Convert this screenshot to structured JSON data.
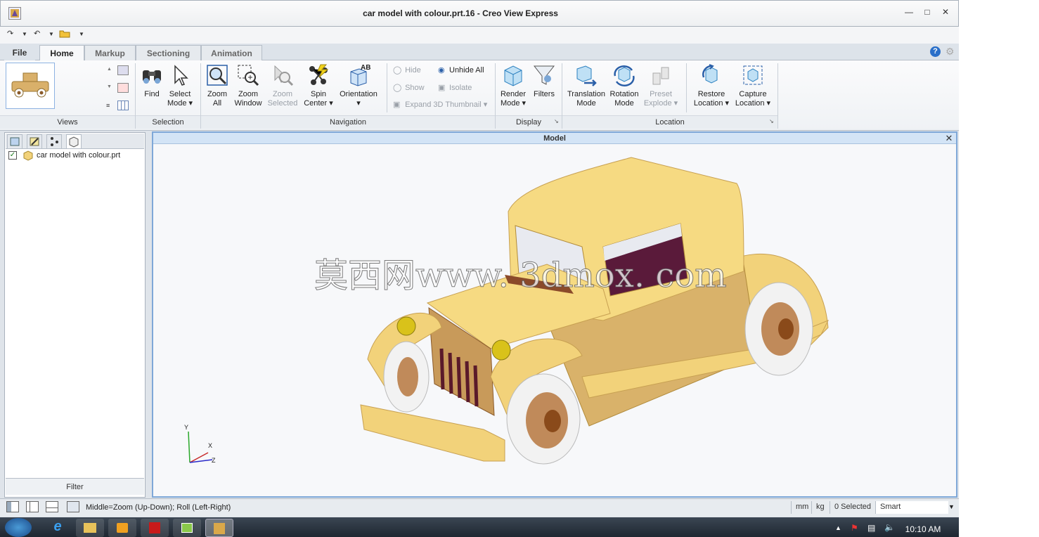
{
  "window": {
    "title": "car model with colour.prt.16 - Creo View Express"
  },
  "tabs": [
    {
      "label": "File"
    },
    {
      "label": "Home"
    },
    {
      "label": "Markup"
    },
    {
      "label": "Sectioning"
    },
    {
      "label": "Animation"
    }
  ],
  "ribbon": {
    "groups": {
      "views": "Views",
      "selection": "Selection",
      "navigation": "Navigation",
      "display": "Display",
      "location": "Location"
    },
    "find": "Find",
    "select_mode": [
      "Select",
      "Mode"
    ],
    "zoom_all": [
      "Zoom",
      "All"
    ],
    "zoom_window": [
      "Zoom",
      "Window"
    ],
    "zoom_selected": [
      "Zoom",
      "Selected"
    ],
    "spin_center": [
      "Spin",
      "Center"
    ],
    "orientation": "Orientation",
    "hide": "Hide",
    "show": "Show",
    "expand_thumb": "Expand 3D Thumbnail",
    "unhide_all": "Unhide All",
    "isolate": "Isolate",
    "render_mode": [
      "Render",
      "Mode"
    ],
    "filters": "Filters",
    "translation_mode": [
      "Translation",
      "Mode"
    ],
    "rotation_mode": [
      "Rotation",
      "Mode"
    ],
    "preset_explode": [
      "Preset",
      "Explode"
    ],
    "restore_location": [
      "Restore",
      "Location"
    ],
    "capture_location": [
      "Capture",
      "Location"
    ]
  },
  "tree": {
    "item": "car model with colour.prt",
    "checked": true
  },
  "filter_label": "Filter",
  "viewport": {
    "title": "Model",
    "watermark": "莫西网www. 3dmox. com"
  },
  "axes": {
    "y": "Y",
    "x": "X",
    "z": "Z"
  },
  "status": {
    "hint": "Middle=Zoom (Up-Down); Roll (Left-Right)",
    "unit_length": "mm",
    "unit_mass": "kg",
    "selected": "0 Selected",
    "mode": "Smart"
  },
  "clock": "10:10 AM",
  "colors": {
    "accent": "#7fa8d8",
    "car_body": "#f2d27a",
    "car_shadow": "#c7a052",
    "window_tint": "#5a1a3a"
  }
}
